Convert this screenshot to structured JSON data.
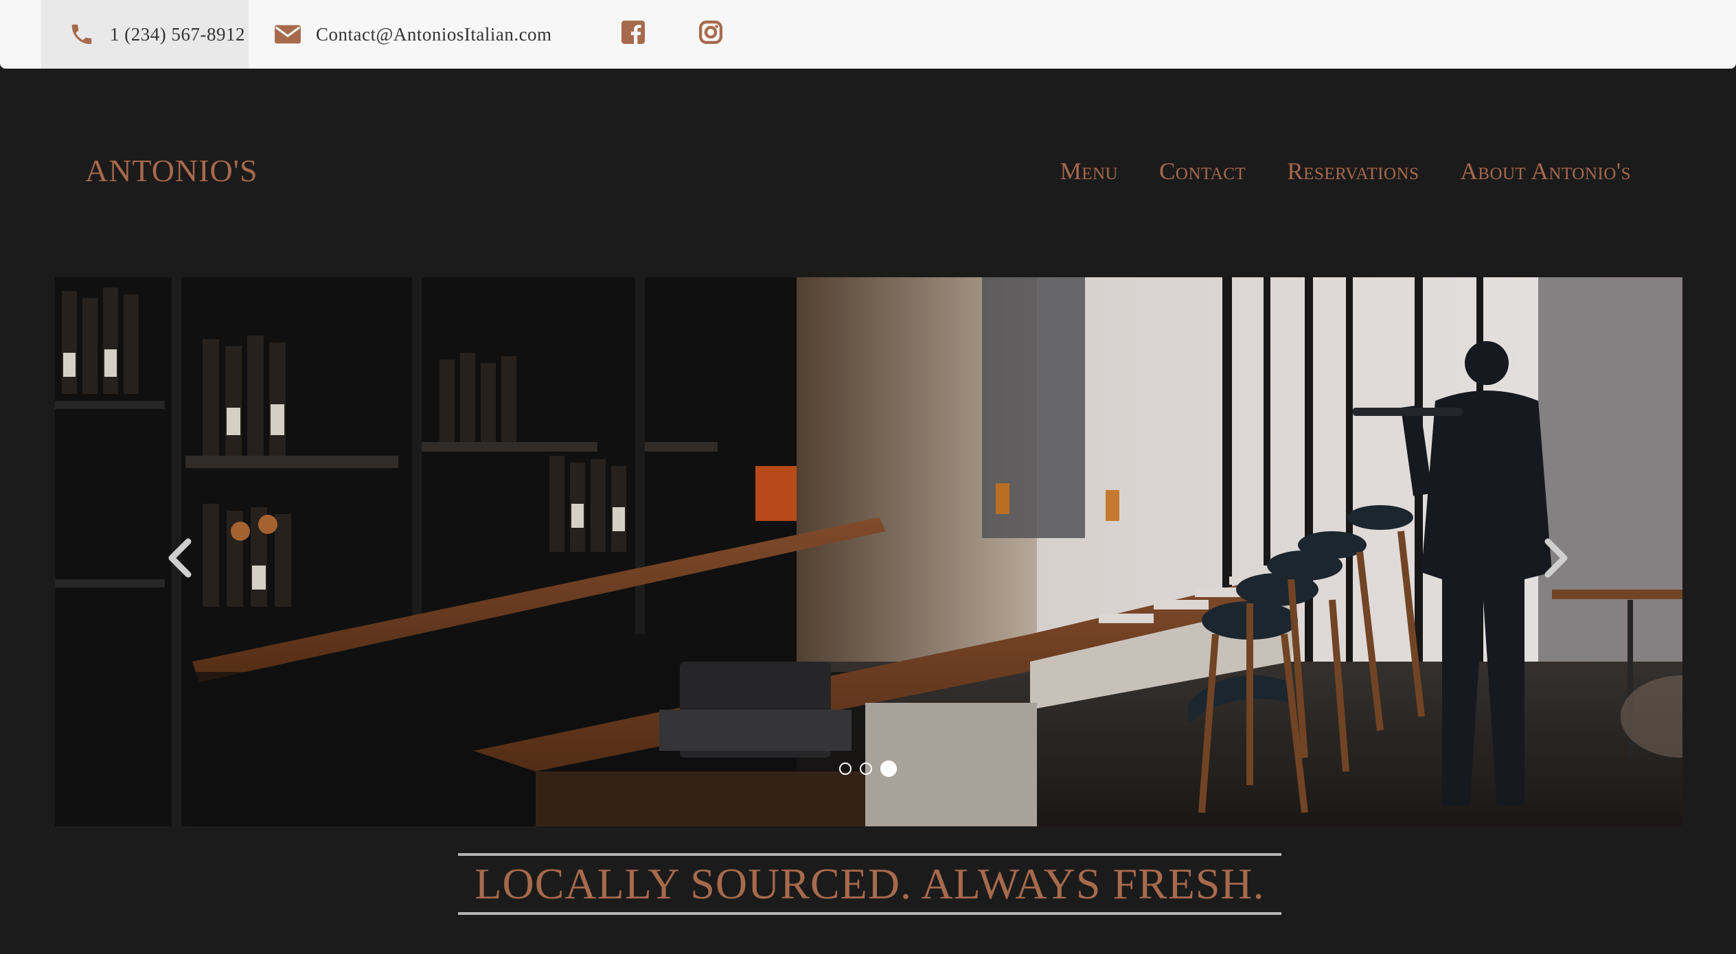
{
  "topbar": {
    "phone": "1 (234) 567-8912",
    "email": "Contact@AntoniosItalian.com",
    "icons": {
      "phone": "phone-icon",
      "email": "envelope-icon",
      "facebook": "facebook-icon",
      "instagram": "instagram-icon"
    }
  },
  "brand": {
    "name": "ANTONIO'S"
  },
  "nav": {
    "items": [
      {
        "label": "Menu"
      },
      {
        "label": "Contact"
      },
      {
        "label": "Reservations"
      },
      {
        "label": "About Antonio's"
      }
    ]
  },
  "carousel": {
    "slide_count": 3,
    "active_index": 2,
    "prev_icon": "chevron-left-icon",
    "next_icon": "chevron-right-icon"
  },
  "tagline": {
    "text": "LOCALLY SOURCED. ALWAYS FRESH."
  },
  "colors": {
    "accent": "#a76a4c",
    "background": "#1c1b1b",
    "topbar": "#f7f7f7",
    "rule": "#b5b5b5"
  }
}
